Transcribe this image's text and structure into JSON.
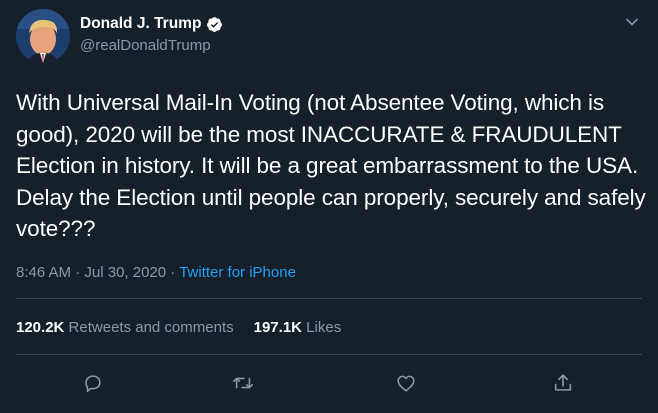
{
  "author": {
    "display_name": "Donald J. Trump",
    "handle": "@realDonaldTrump",
    "verified": true
  },
  "tweet": {
    "text": "With Universal Mail-In Voting (not Absentee Voting, which is good), 2020 will be the most INACCURATE & FRAUDULENT Election in history. It will be a great embarrassment to the USA. Delay the Election until people can properly, securely and safely vote???",
    "time": "8:46 AM",
    "date": "Jul 30, 2020",
    "separator": "·",
    "source": "Twitter for iPhone"
  },
  "stats": {
    "retweets_count": "120.2K",
    "retweets_label": "Retweets and comments",
    "likes_count": "197.1K",
    "likes_label": "Likes"
  },
  "icons": {
    "verified": "verified-badge-icon",
    "caret": "chevron-down-icon",
    "reply": "reply-icon",
    "retweet": "retweet-icon",
    "like": "like-icon",
    "share": "share-icon"
  },
  "colors": {
    "background": "#15202b",
    "text": "#ffffff",
    "secondary_text": "#8899a6",
    "link": "#1da1f2",
    "divider": "#38444d"
  }
}
